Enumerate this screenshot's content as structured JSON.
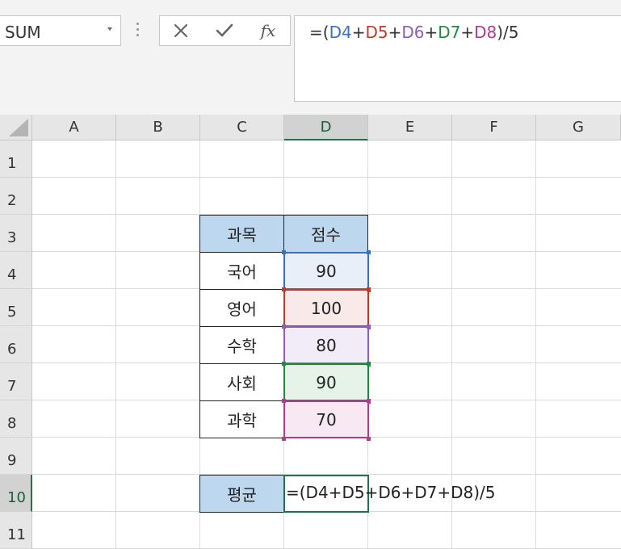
{
  "name_box": {
    "value": "SUM"
  },
  "formula_bar": {
    "tokens": [
      {
        "text": "=(",
        "color": "#333333"
      },
      {
        "text": "D4",
        "color": "#3a6fc4"
      },
      {
        "text": "+",
        "color": "#333333"
      },
      {
        "text": "D5",
        "color": "#c0392b"
      },
      {
        "text": "+",
        "color": "#333333"
      },
      {
        "text": "D6",
        "color": "#8e5bbf"
      },
      {
        "text": "+",
        "color": "#333333"
      },
      {
        "text": "D7",
        "color": "#1e8a3c"
      },
      {
        "text": "+",
        "color": "#333333"
      },
      {
        "text": "D8",
        "color": "#b03c8a"
      },
      {
        "text": ")/5",
        "color": "#333333"
      }
    ]
  },
  "columns": [
    "A",
    "B",
    "C",
    "D",
    "E",
    "F",
    "G"
  ],
  "rows": [
    "1",
    "2",
    "3",
    "4",
    "5",
    "6",
    "7",
    "8",
    "9",
    "10",
    "11"
  ],
  "selected_column": "D",
  "selected_row": "10",
  "table": {
    "header_subject": "과목",
    "header_score": "점수",
    "rows": [
      {
        "subject": "국어",
        "score": "90",
        "ref_color": "#3a6fc4",
        "fill": "#e9eff9"
      },
      {
        "subject": "영어",
        "score": "100",
        "ref_color": "#c0392b",
        "fill": "#f9e9e9"
      },
      {
        "subject": "수학",
        "score": "80",
        "ref_color": "#8e5bbf",
        "fill": "#f1ecf8"
      },
      {
        "subject": "사회",
        "score": "90",
        "ref_color": "#1e8a3c",
        "fill": "#e5f3e9"
      },
      {
        "subject": "과학",
        "score": "70",
        "ref_color": "#b03c8a",
        "fill": "#f7e8f2"
      }
    ]
  },
  "average": {
    "label": "평균",
    "formula": "=(D4+D5+D6+D7+D8)/5"
  },
  "colors": {
    "accent": "#217346",
    "header_fill": "#bdd7ee"
  }
}
